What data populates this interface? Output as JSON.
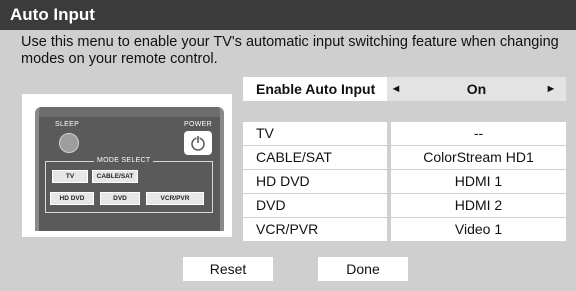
{
  "menu": {
    "title": "Auto Input",
    "description": "Use this menu to enable your TV's automatic input switching feature when changing modes on your remote control."
  },
  "remote": {
    "sleep_label": "SLEEP",
    "power_label": "POWER",
    "mode_select_label": "MODE SELECT",
    "mode_buttons": [
      "TV",
      "CABLE/SAT",
      "HD DVD",
      "DVD",
      "VCR/PVR"
    ]
  },
  "enable": {
    "label": "Enable Auto Input",
    "value": "On",
    "left_arrow": "◄",
    "right_arrow": "►"
  },
  "inputs": [
    {
      "name": "TV",
      "value": "--"
    },
    {
      "name": "CABLE/SAT",
      "value": "ColorStream HD1"
    },
    {
      "name": "HD DVD",
      "value": "HDMI 1"
    },
    {
      "name": "DVD",
      "value": "HDMI 2"
    },
    {
      "name": "VCR/PVR",
      "value": "Video 1"
    }
  ],
  "buttons": {
    "reset": "Reset",
    "done": "Done"
  },
  "colors": {
    "title_bar": "#3b3b3b",
    "panel": "#cfcfcf",
    "selected_value": "#e3e3e3"
  }
}
